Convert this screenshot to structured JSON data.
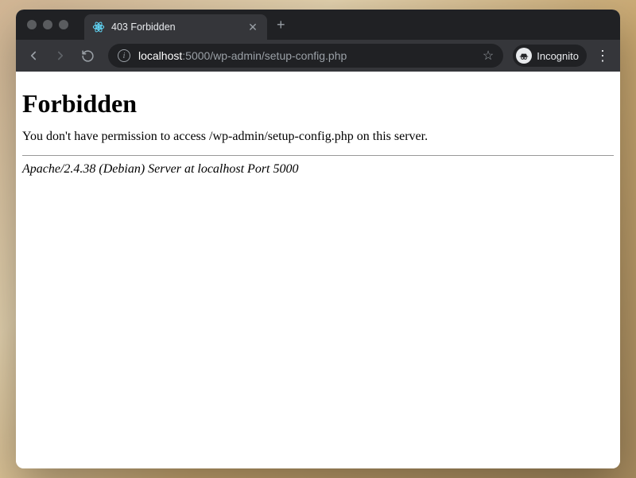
{
  "browser": {
    "tab": {
      "title": "403 Forbidden"
    },
    "url": {
      "host": "localhost",
      "port_path": ":5000/wp-admin/setup-config.php"
    },
    "incognito_label": "Incognito"
  },
  "page": {
    "heading": "Forbidden",
    "message": "You don't have permission to access /wp-admin/setup-config.php on this server.",
    "server_line": "Apache/2.4.38 (Debian) Server at localhost Port 5000"
  }
}
